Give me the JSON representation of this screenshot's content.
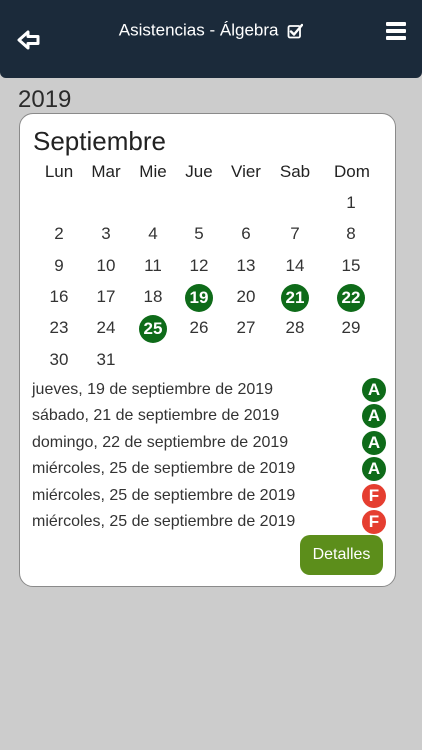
{
  "header": {
    "title": "Asistencias - Álgebra"
  },
  "year": "2019",
  "calendar": {
    "month": "Septiembre",
    "weekdays": [
      "Lun",
      "Mar",
      "Mie",
      "Jue",
      "Vier",
      "Sab",
      "Dom"
    ],
    "weeks": [
      [
        "",
        "",
        "",
        "",
        "",
        "",
        "1"
      ],
      [
        "2",
        "3",
        "4",
        "5",
        "6",
        "7",
        "8"
      ],
      [
        "9",
        "10",
        "11",
        "12",
        "13",
        "14",
        "15"
      ],
      [
        "16",
        "17",
        "18",
        "19",
        "20",
        "21",
        "22"
      ],
      [
        "23",
        "24",
        "25",
        "26",
        "27",
        "28",
        "29"
      ],
      [
        "30",
        "31",
        "",
        "",
        "",
        "",
        ""
      ]
    ],
    "marked_days": [
      "19",
      "21",
      "22",
      "25"
    ],
    "marked_color": "#0e6b19"
  },
  "records": [
    {
      "date": "jueves, 19 de septiembre de 2019",
      "status": "A",
      "color": "#0e6b19"
    },
    {
      "date": "sábado, 21 de septiembre de 2019",
      "status": "A",
      "color": "#0e6b19"
    },
    {
      "date": "domingo, 22 de septiembre de 2019",
      "status": "A",
      "color": "#0e6b19"
    },
    {
      "date": "miércoles, 25 de septiembre de 2019",
      "status": "A",
      "color": "#0e6b19"
    },
    {
      "date": "miércoles, 25 de septiembre de 2019",
      "status": "F",
      "color": "#e53e30"
    },
    {
      "date": "miércoles, 25 de septiembre de 2019",
      "status": "F",
      "color": "#e53e30"
    }
  ],
  "details_label": "Detalles",
  "icons": {
    "back": "arrow-left-icon",
    "title_check": "checkbox-icon",
    "menu": "hamburger-menu-icon"
  },
  "colors": {
    "header_bg": "#1b2a3a",
    "background": "#cccccc",
    "details_button": "#5c8e1b"
  }
}
